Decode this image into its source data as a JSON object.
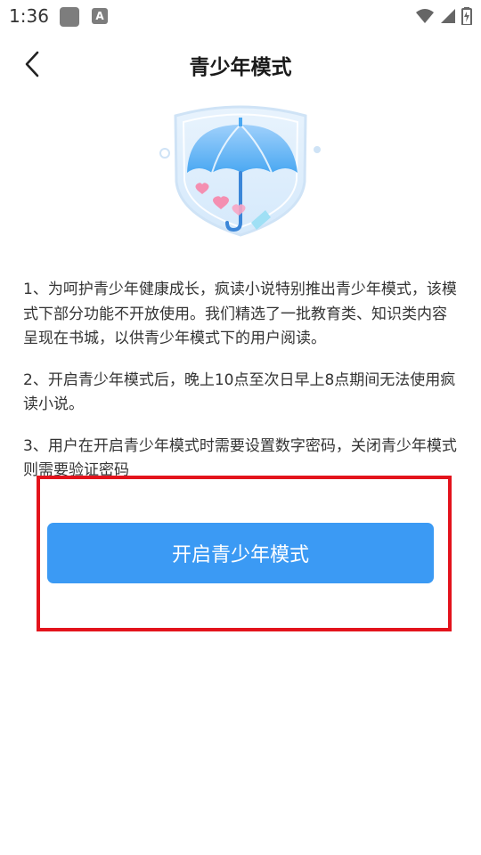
{
  "status_bar": {
    "time": "1:36",
    "icons": [
      "app-icon",
      "a-badge-icon",
      "wifi-icon",
      "signal-icon",
      "battery-icon"
    ]
  },
  "nav": {
    "title": "青少年模式",
    "back_icon": "chevron-left-icon"
  },
  "hero": {
    "icon": "umbrella-shield-illustration"
  },
  "content": {
    "paragraphs": [
      "1、为呵护青少年健康成长，疯读小说特别推出青少年模式，该模式下部分功能不开放使用。我们精选了一批教育类、知识类内容呈现在书城，以供青少年模式下的用户阅读。",
      "2、开启青少年模式后，晚上10点至次日早上8点期间无法使用疯读小说。",
      "3、用户在开启青少年模式时需要设置数字密码，关闭青少年模式则需要验证密码"
    ]
  },
  "action": {
    "enable_label": "开启青少年模式"
  },
  "colors": {
    "accent": "#3b9af4",
    "highlight": "#e3131c",
    "text": "#333333"
  }
}
